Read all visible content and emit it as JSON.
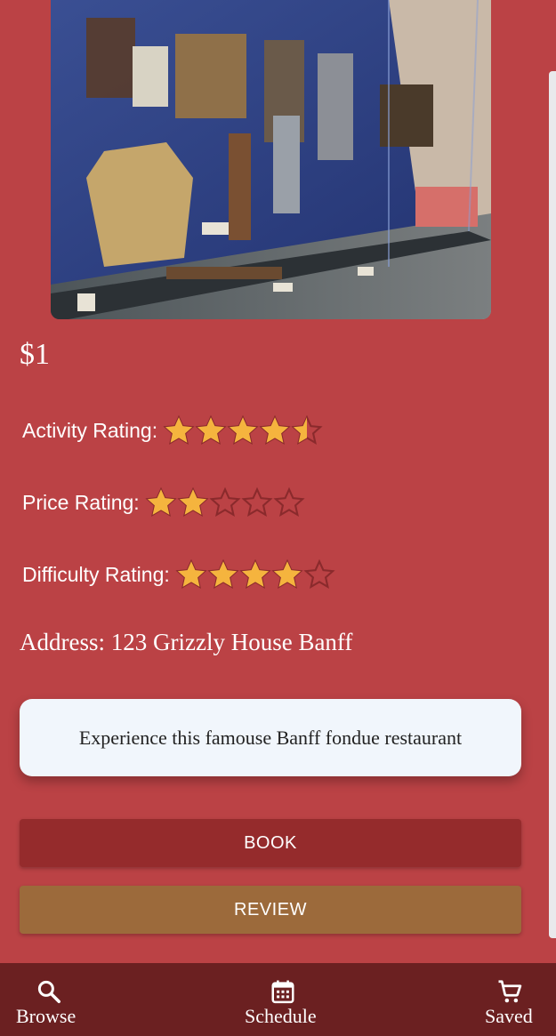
{
  "listing": {
    "price": "$1",
    "ratings": [
      {
        "label": "Activity Rating:",
        "value": 4.5,
        "max": 5
      },
      {
        "label": "Price Rating:",
        "value": 2,
        "max": 5
      },
      {
        "label": "Difficulty Rating:",
        "value": 4,
        "max": 5
      }
    ],
    "address": "Address: 123 Grizzly House Banff",
    "description": "Experience this famouse Banff fondue restaurant"
  },
  "actions": {
    "book_label": "BOOK",
    "review_label": "REVIEW"
  },
  "nav": {
    "items": [
      {
        "label": "Browse",
        "icon": "search-icon"
      },
      {
        "label": "Schedule",
        "icon": "calendar-icon"
      },
      {
        "label": "Saved",
        "icon": "cart-icon"
      }
    ]
  },
  "colors": {
    "background": "#bb4245",
    "star_filled": "#f5b43e",
    "star_empty_outline": "#8a2a2c",
    "book_button": "#952b2c",
    "review_button": "#9c6a3b",
    "nav_bar": "#6b2021",
    "description_card": "#f1f6fc"
  }
}
